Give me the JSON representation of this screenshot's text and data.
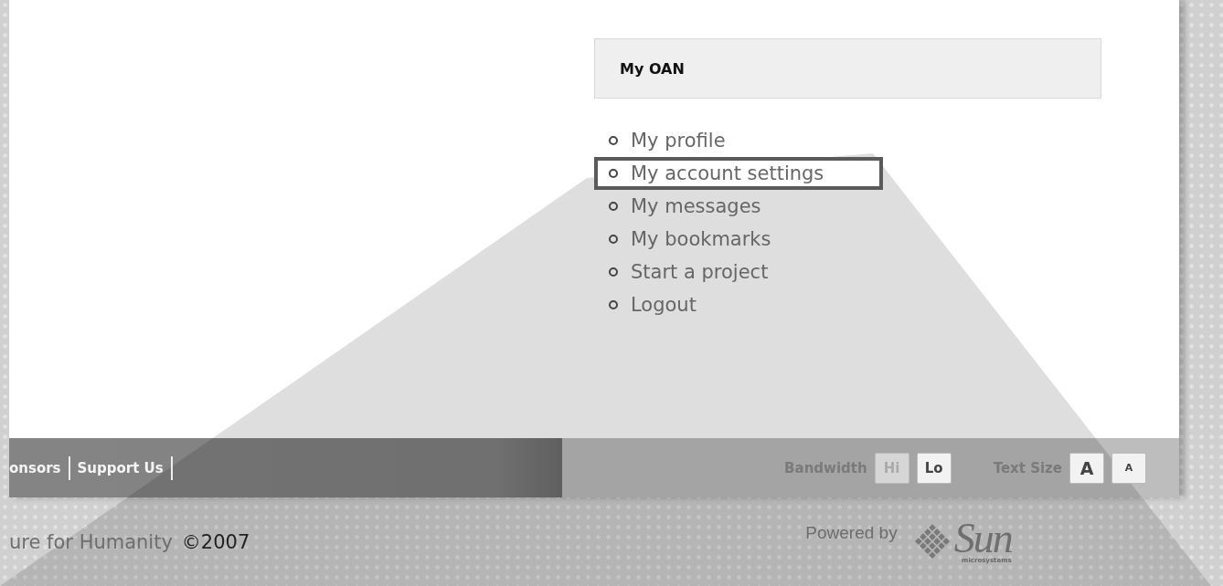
{
  "panel": {
    "title": "My OAN"
  },
  "menu": [
    {
      "label": "My profile",
      "selected": false
    },
    {
      "label": "My account settings",
      "selected": true
    },
    {
      "label": "My messages",
      "selected": false
    },
    {
      "label": "My bookmarks",
      "selected": false
    },
    {
      "label": "Start a project",
      "selected": false
    },
    {
      "label": "Logout",
      "selected": false
    }
  ],
  "footer_links": [
    "onsors",
    "Support Us"
  ],
  "bandwidth": {
    "label": "Bandwidth",
    "options": [
      {
        "label": "Hi",
        "selected": true
      },
      {
        "label": "Lo",
        "selected": false
      }
    ]
  },
  "text_size": {
    "label": "Text Size",
    "options": [
      {
        "label": "A",
        "kind": "large"
      },
      {
        "label": "A",
        "kind": "small"
      }
    ]
  },
  "copyright": {
    "text": "ure for Humanity",
    "year": "©2007"
  },
  "powered": {
    "label": "Powered by",
    "brand": "Sun",
    "sub": "microsystems"
  }
}
